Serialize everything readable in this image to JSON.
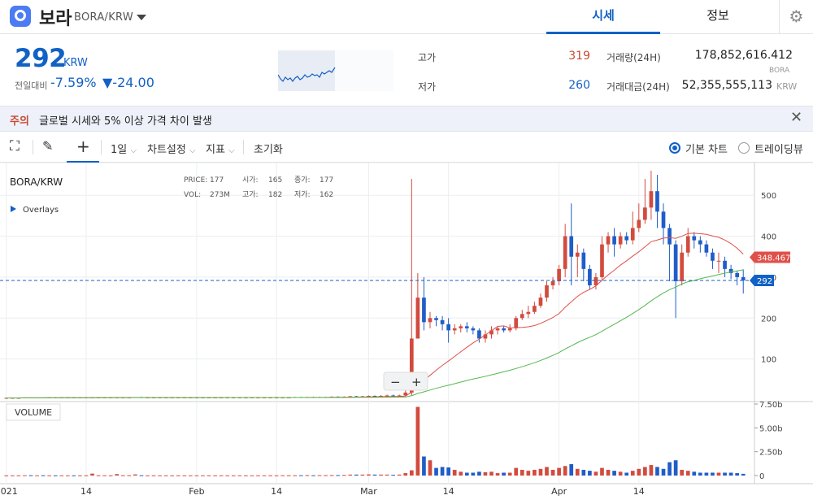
{
  "header": {
    "coin_name": "보라",
    "pair": "BORA/KRW",
    "tabs": [
      "시세",
      "정보"
    ],
    "logo_icon": "bora-logo-icon",
    "settings_icon": "gear-icon"
  },
  "summary": {
    "price": "292",
    "unit": "KRW",
    "change_label": "전일대비",
    "change_pct": "-7.59%",
    "change_amt": "▼-24.00",
    "high_label": "고가",
    "high": "319",
    "low_label": "저가",
    "low": "260",
    "volume_label": "거래량(24H)",
    "volume": "178,852,616.412",
    "volume_unit": "BORA",
    "value_label": "거래대금(24H)",
    "value": "52,355,555,113",
    "value_unit": "KRW",
    "colors": {
      "up": "#c84a31",
      "down": "#1261c4"
    }
  },
  "warning": {
    "tag": "주의",
    "text": "글로벌 시세와 5% 이상 가격 차이 발생"
  },
  "toolbar": {
    "period": "1일",
    "chart_settings": "차트설정",
    "indicators": "지표",
    "reset": "초기화",
    "basic_chart": "기본 차트",
    "tradingview": "트레이딩뷰"
  },
  "chart_data": {
    "type": "candlestick",
    "symbol": "BORA/KRW",
    "legend": {
      "price_label": "PRICE:",
      "price": "177",
      "open_label": "시가:",
      "open": "165",
      "close_label": "종가:",
      "close": "177",
      "vol_label": "VOL:",
      "vol": "273M",
      "high_label": "고가:",
      "high": "182",
      "low_label": "저가:",
      "low": "162"
    },
    "overlays_label": "Overlays",
    "volume_label": "VOLUME",
    "x_ticks": [
      "2021",
      "14",
      "Feb",
      "14",
      "Mar",
      "14",
      "Apr",
      "14"
    ],
    "y_ticks": [
      100,
      200,
      300,
      400,
      500
    ],
    "y_range": [
      0,
      560
    ],
    "volume_ticks": [
      "0",
      "2.50b",
      "5.00b",
      "7.50b"
    ],
    "current_price": "292",
    "ma_value": "348.467",
    "zoom_minus": "−",
    "zoom_plus": "+",
    "candles": [
      [
        5,
        5,
        6,
        4,
        0.02
      ],
      [
        5,
        5,
        6,
        4,
        0.02
      ],
      [
        5,
        5,
        6,
        4,
        0.02
      ],
      [
        5,
        6,
        6,
        4,
        0.03
      ],
      [
        6,
        5,
        6,
        4,
        0.03
      ],
      [
        5,
        6,
        6,
        5,
        0.02
      ],
      [
        6,
        5,
        6,
        5,
        0.03
      ],
      [
        5,
        6,
        7,
        5,
        0.02
      ],
      [
        6,
        5,
        7,
        5,
        0.02
      ],
      [
        5,
        6,
        7,
        5,
        0.02
      ],
      [
        6,
        6,
        7,
        5,
        0.02
      ],
      [
        6,
        5,
        7,
        5,
        0.02
      ],
      [
        5,
        6,
        7,
        5,
        0.02
      ],
      [
        6,
        6,
        7,
        5,
        0.02
      ],
      [
        6,
        6,
        7,
        5,
        0.2
      ],
      [
        6,
        6,
        7,
        5,
        0.03
      ],
      [
        6,
        6,
        7,
        5,
        0.03
      ],
      [
        6,
        6,
        7,
        5,
        0.02
      ],
      [
        6,
        6,
        7,
        5,
        0.15
      ],
      [
        6,
        6,
        7,
        5,
        0.03
      ],
      [
        6,
        6,
        7,
        5,
        0.03
      ],
      [
        6,
        7,
        7,
        5,
        0.12
      ],
      [
        7,
        6,
        8,
        5,
        0.03
      ],
      [
        6,
        6,
        7,
        5,
        0.02
      ],
      [
        6,
        6,
        7,
        5,
        0.02
      ],
      [
        6,
        6,
        7,
        5,
        0.02
      ],
      [
        6,
        6,
        7,
        5,
        0.02
      ],
      [
        6,
        6,
        7,
        5,
        0.02
      ],
      [
        6,
        6,
        7,
        5,
        0.02
      ],
      [
        6,
        6,
        7,
        5,
        0.02
      ],
      [
        6,
        6,
        7,
        5,
        0.02
      ],
      [
        6,
        6,
        7,
        5,
        0.02
      ],
      [
        6,
        6,
        7,
        5,
        0.02
      ],
      [
        6,
        6,
        7,
        5,
        0.02
      ],
      [
        6,
        6,
        7,
        5,
        0.02
      ],
      [
        6,
        6,
        7,
        5,
        0.02
      ],
      [
        6,
        6,
        7,
        5,
        0.02
      ],
      [
        6,
        6,
        7,
        5,
        0.02
      ],
      [
        6,
        6,
        7,
        5,
        0.02
      ],
      [
        6,
        6,
        7,
        5,
        0.02
      ],
      [
        6,
        6,
        7,
        5,
        0.02
      ],
      [
        6,
        6,
        7,
        5,
        0.02
      ],
      [
        6,
        6,
        7,
        5,
        0.02
      ],
      [
        6,
        6,
        7,
        5,
        0.02
      ],
      [
        6,
        6,
        7,
        5,
        0.02
      ],
      [
        6,
        6,
        7,
        5,
        0.03
      ],
      [
        6,
        6,
        7,
        5,
        0.03
      ],
      [
        6,
        7,
        8,
        5,
        0.03
      ],
      [
        7,
        6,
        8,
        5,
        0.03
      ],
      [
        6,
        7,
        8,
        6,
        0.04
      ],
      [
        7,
        6,
        8,
        6,
        0.03
      ],
      [
        6,
        7,
        8,
        6,
        0.04
      ],
      [
        7,
        7,
        8,
        6,
        0.04
      ],
      [
        7,
        8,
        9,
        6,
        0.05
      ],
      [
        8,
        7,
        9,
        6,
        0.05
      ],
      [
        7,
        8,
        9,
        7,
        0.06
      ],
      [
        8,
        9,
        10,
        7,
        0.1
      ],
      [
        9,
        8,
        10,
        7,
        0.1
      ],
      [
        8,
        9,
        10,
        7,
        0.1
      ],
      [
        9,
        10,
        11,
        8,
        0.12
      ],
      [
        10,
        9,
        11,
        8,
        0.1
      ],
      [
        9,
        10,
        12,
        8,
        0.1
      ],
      [
        10,
        11,
        13,
        9,
        0.1
      ],
      [
        11,
        10,
        13,
        9,
        0.08
      ],
      [
        10,
        11,
        13,
        9,
        0.1
      ],
      [
        11,
        18,
        25,
        10,
        0.25
      ],
      [
        18,
        150,
        540,
        10,
        0.55
      ],
      [
        150,
        250,
        310,
        150,
        7.2
      ],
      [
        250,
        190,
        300,
        170,
        2.0
      ],
      [
        190,
        200,
        215,
        175,
        1.6
      ],
      [
        200,
        195,
        205,
        180,
        0.8
      ],
      [
        195,
        185,
        205,
        170,
        0.9
      ],
      [
        185,
        170,
        200,
        140,
        0.85
      ],
      [
        170,
        175,
        185,
        160,
        0.6
      ],
      [
        175,
        180,
        185,
        165,
        0.4
      ],
      [
        180,
        175,
        190,
        165,
        0.3
      ],
      [
        175,
        170,
        180,
        160,
        0.3
      ],
      [
        170,
        150,
        175,
        140,
        0.4
      ],
      [
        150,
        160,
        170,
        140,
        0.35
      ],
      [
        160,
        170,
        180,
        150,
        0.4
      ],
      [
        170,
        175,
        180,
        160,
        0.25
      ],
      [
        175,
        170,
        180,
        165,
        0.3
      ],
      [
        170,
        175,
        185,
        165,
        0.3
      ],
      [
        175,
        200,
        205,
        170,
        0.8
      ],
      [
        200,
        210,
        220,
        195,
        0.6
      ],
      [
        210,
        215,
        230,
        200,
        0.5
      ],
      [
        215,
        230,
        240,
        210,
        0.6
      ],
      [
        230,
        250,
        260,
        225,
        0.7
      ],
      [
        250,
        280,
        290,
        240,
        0.9
      ],
      [
        280,
        290,
        300,
        270,
        0.6
      ],
      [
        290,
        320,
        330,
        280,
        0.8
      ],
      [
        320,
        400,
        430,
        300,
        1.0
      ],
      [
        400,
        350,
        480,
        280,
        1.2
      ],
      [
        350,
        360,
        380,
        300,
        0.7
      ],
      [
        360,
        320,
        370,
        290,
        0.6
      ],
      [
        320,
        280,
        330,
        270,
        0.5
      ],
      [
        280,
        300,
        310,
        270,
        0.4
      ],
      [
        300,
        380,
        400,
        290,
        0.8
      ],
      [
        380,
        400,
        410,
        360,
        0.6
      ],
      [
        400,
        380,
        420,
        350,
        0.5
      ],
      [
        380,
        400,
        410,
        370,
        0.4
      ],
      [
        400,
        390,
        410,
        380,
        0.3
      ],
      [
        390,
        420,
        460,
        380,
        0.5
      ],
      [
        420,
        440,
        480,
        410,
        0.7
      ],
      [
        440,
        470,
        540,
        430,
        0.9
      ],
      [
        470,
        510,
        560,
        440,
        1.1
      ],
      [
        510,
        460,
        550,
        420,
        0.9
      ],
      [
        460,
        420,
        480,
        380,
        0.7
      ],
      [
        420,
        380,
        430,
        290,
        1.4
      ],
      [
        380,
        290,
        390,
        200,
        1.6
      ],
      [
        290,
        360,
        380,
        280,
        0.6
      ],
      [
        360,
        400,
        420,
        350,
        0.5
      ],
      [
        400,
        390,
        410,
        370,
        0.4
      ],
      [
        390,
        380,
        400,
        360,
        0.3
      ],
      [
        380,
        360,
        390,
        350,
        0.3
      ],
      [
        360,
        340,
        370,
        320,
        0.3
      ],
      [
        340,
        340,
        360,
        310,
        0.3
      ],
      [
        340,
        320,
        350,
        300,
        0.3
      ],
      [
        320,
        310,
        330,
        295,
        0.3
      ],
      [
        310,
        300,
        315,
        280,
        0.25
      ],
      [
        300,
        292,
        319,
        260,
        0.18
      ]
    ],
    "series": [
      {
        "name": "MA short",
        "color": "#e0504a"
      },
      {
        "name": "MA long",
        "color": "#55b84e"
      }
    ]
  }
}
